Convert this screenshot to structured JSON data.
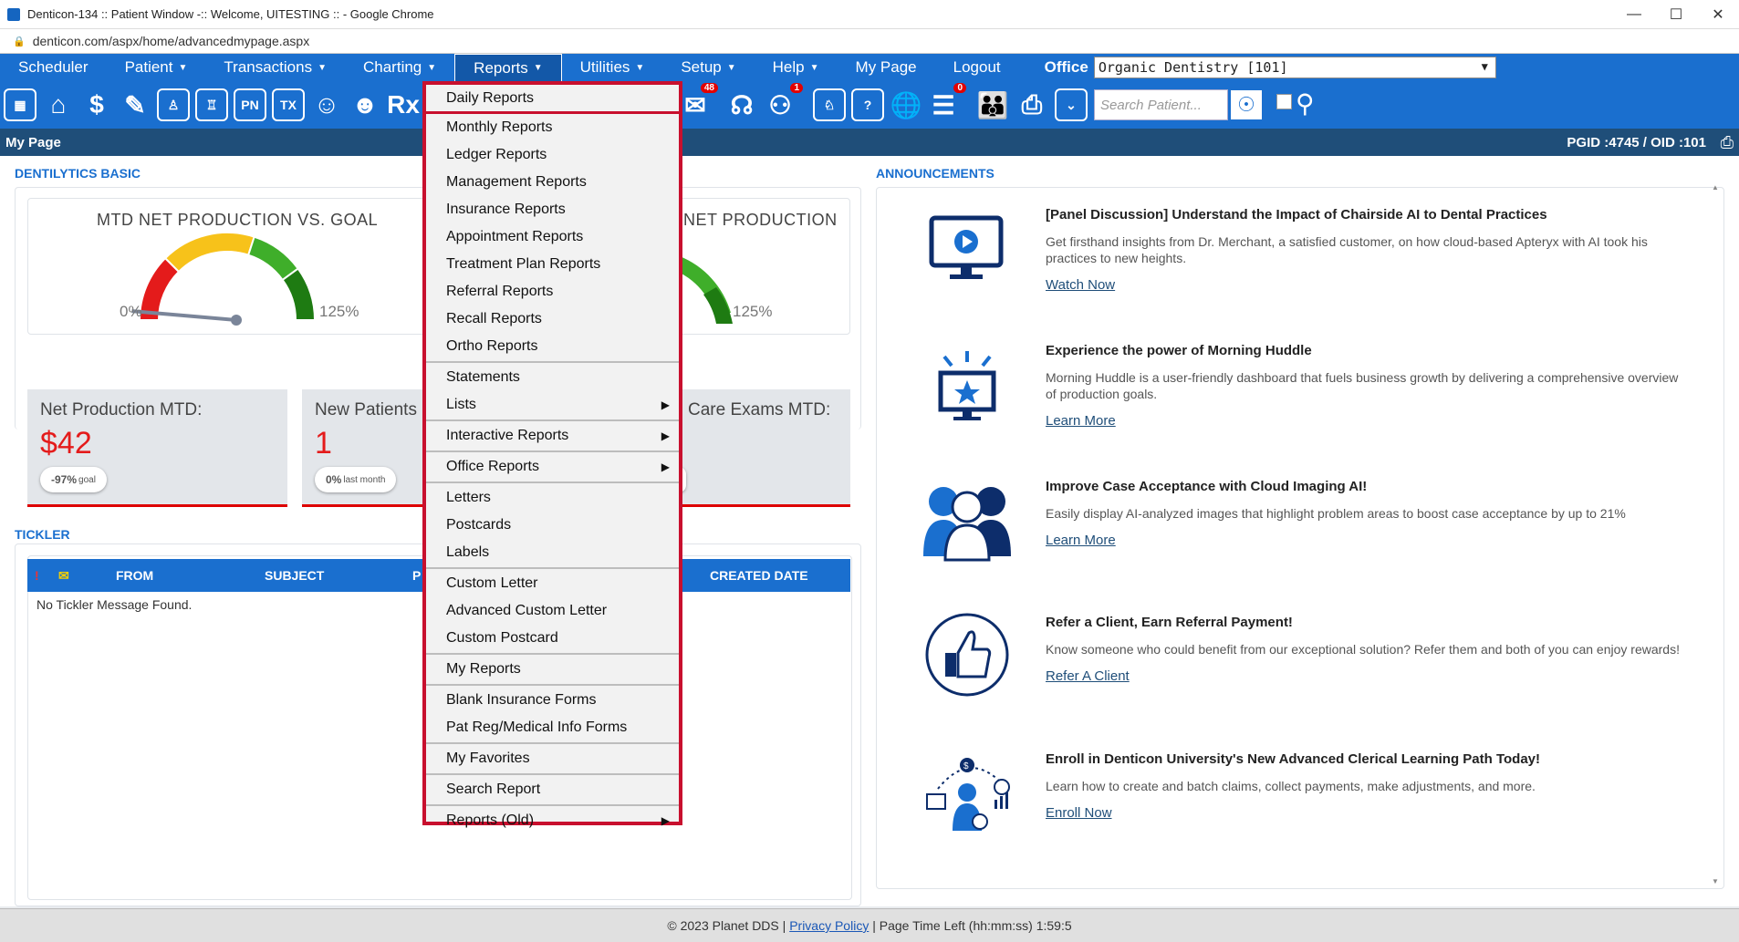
{
  "window": {
    "title": "Denticon-134 :: Patient Window -:: Welcome, UITESTING :: - Google Chrome",
    "url": "denticon.com/aspx/home/advancedmypage.aspx"
  },
  "nav": {
    "items": [
      {
        "label": "Scheduler",
        "caret": false
      },
      {
        "label": "Patient",
        "caret": true
      },
      {
        "label": "Transactions",
        "caret": true
      },
      {
        "label": "Charting",
        "caret": true
      },
      {
        "label": "Reports",
        "caret": true
      },
      {
        "label": "Utilities",
        "caret": true
      },
      {
        "label": "Setup",
        "caret": true
      },
      {
        "label": "Help",
        "caret": true
      },
      {
        "label": "My Page",
        "caret": false
      },
      {
        "label": "Logout",
        "caret": false
      }
    ],
    "office_label": "Office",
    "office_value": "Organic Dentistry [101]"
  },
  "toolbar": {
    "icons": [
      "calendar-icon",
      "home-icon",
      "dollar-icon",
      "pencil-chart-icon",
      "tooth-icon",
      "tooth-x-icon",
      "pn-icon",
      "tx-icon",
      "add-patient-icon",
      "add-family-icon",
      "rx-icon"
    ],
    "pn_label": "PN",
    "tx_label": "TX",
    "rx_label": "Rx",
    "badge_messages": "48",
    "badge_alerts": "1",
    "badge_docs": "0",
    "search_placeholder": "Search Patient..."
  },
  "pagebar": {
    "title": "My Page",
    "pgid": "PGID :4745  /  OID :101"
  },
  "dentilytics": {
    "section_label": "DENTILYTICS BASIC",
    "gauge1": {
      "title": "MTD NET PRODUCTION VS. GOAL",
      "value": "3%",
      "min": "0%",
      "max": "125%",
      "fraction": 0.03
    },
    "gauge2": {
      "title": "NET PRODUCTION",
      "max": "125%"
    },
    "stats": [
      {
        "title": "Net Production MTD:",
        "value": "$42",
        "pill": "-97%",
        "pill_sub": "goal"
      },
      {
        "title": "New Patients",
        "value": "1",
        "pill": "0%",
        "pill_sub": "last month"
      },
      {
        "title": "Care Exams MTD:"
      }
    ]
  },
  "tickler": {
    "section_label": "TICKLER",
    "columns": [
      "FROM",
      "SUBJECT",
      "P",
      "CREATED DATE"
    ],
    "empty": "No Tickler Message Found."
  },
  "announcements": {
    "section_label": "ANNOUNCEMENTS",
    "items": [
      {
        "title": "[Panel Discussion] Understand the Impact of Chairside AI to Dental Practices",
        "desc": "Get firsthand insights from Dr. Merchant, a satisfied customer, on how cloud-based Apteryx with AI took his practices to new heights.",
        "link": "Watch Now",
        "icon": "monitor-play-icon"
      },
      {
        "title": "Experience the power of Morning Huddle",
        "desc": "Morning Huddle is a user-friendly dashboard that fuels business growth by delivering a comprehensive overview of production goals.",
        "link": "Learn More",
        "icon": "monitor-star-icon"
      },
      {
        "title": "Improve Case Acceptance with Cloud Imaging AI!",
        "desc": "Easily display AI-analyzed images that highlight problem areas to boost case acceptance by up to 21%",
        "link": "Learn More",
        "icon": "people-group-icon"
      },
      {
        "title": "Refer a Client, Earn Referral Payment!",
        "desc": "Know someone who could benefit from our exceptional solution? Refer them and both of you can enjoy rewards!",
        "link": "Refer A Client",
        "icon": "thumbs-up-icon"
      },
      {
        "title": "Enroll in Denticon University's New Advanced Clerical Learning Path Today!",
        "desc": "Learn how to create and batch claims, collect payments, make adjustments, and more.",
        "link": "Enroll Now",
        "icon": "learner-icon"
      }
    ]
  },
  "reports_menu": {
    "groups": [
      [
        {
          "label": "Daily Reports"
        }
      ],
      [
        {
          "label": "Monthly Reports"
        },
        {
          "label": "Ledger Reports"
        },
        {
          "label": "Management Reports"
        },
        {
          "label": "Insurance Reports"
        },
        {
          "label": "Appointment Reports"
        },
        {
          "label": "Treatment Plan Reports"
        },
        {
          "label": "Referral Reports"
        },
        {
          "label": "Recall Reports"
        },
        {
          "label": "Ortho Reports"
        }
      ],
      [
        {
          "label": "Statements"
        },
        {
          "label": "Lists",
          "submenu": true
        }
      ],
      [
        {
          "label": "Interactive Reports",
          "submenu": true
        }
      ],
      [
        {
          "label": "Office Reports",
          "submenu": true
        }
      ],
      [
        {
          "label": "Letters"
        },
        {
          "label": "Postcards"
        },
        {
          "label": "Labels"
        }
      ],
      [
        {
          "label": "Custom Letter"
        },
        {
          "label": "Advanced Custom Letter"
        },
        {
          "label": "Custom Postcard"
        }
      ],
      [
        {
          "label": "My Reports"
        }
      ],
      [
        {
          "label": "Blank Insurance Forms"
        },
        {
          "label": "Pat Reg/Medical Info Forms"
        }
      ],
      [
        {
          "label": "My Favorites"
        }
      ],
      [
        {
          "label": "Search Report"
        }
      ],
      [
        {
          "label": "Reports (Old)",
          "submenu": true
        }
      ]
    ]
  },
  "footer": {
    "copyright": "© 2023 Planet DDS |",
    "privacy": "Privacy Policy",
    "time_left": "| Page Time Left (hh:mm:ss) 1:59:5"
  }
}
